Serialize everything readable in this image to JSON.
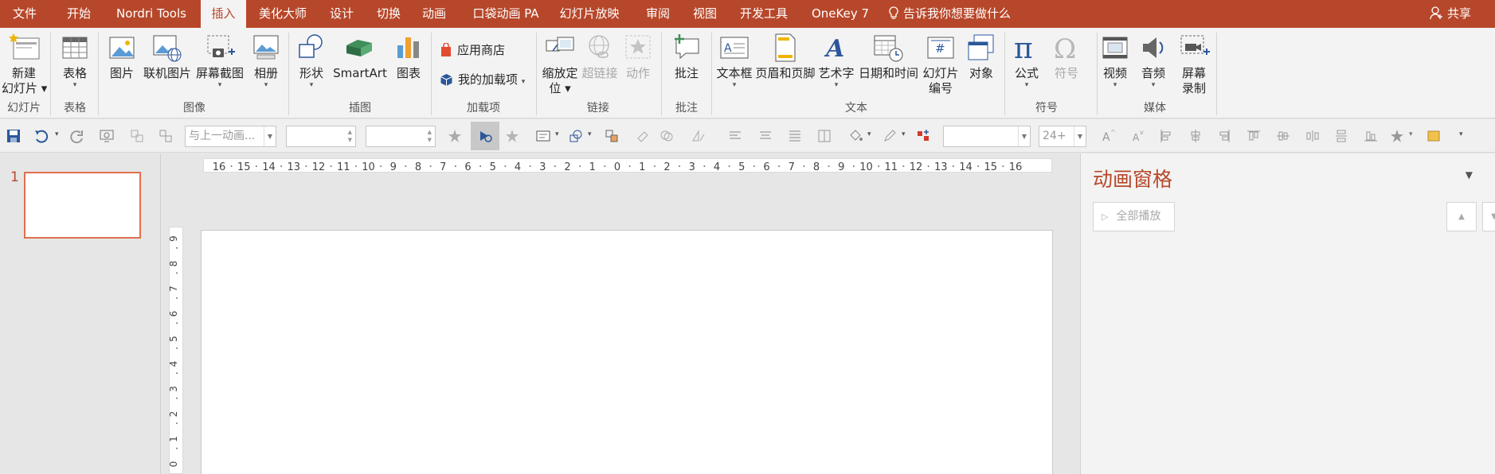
{
  "tabs": [
    {
      "label": "文件",
      "active": false
    },
    {
      "label": "开始",
      "active": false
    },
    {
      "label": "Nordri Tools",
      "active": false
    },
    {
      "label": "插入",
      "active": true
    },
    {
      "label": "美化大师",
      "active": false
    },
    {
      "label": "设计",
      "active": false
    },
    {
      "label": "切换",
      "active": false
    },
    {
      "label": "动画",
      "active": false
    },
    {
      "label": "口袋动画 PA",
      "active": false
    },
    {
      "label": "幻灯片放映",
      "active": false
    },
    {
      "label": "审阅",
      "active": false
    },
    {
      "label": "视图",
      "active": false
    },
    {
      "label": "开发工具",
      "active": false
    },
    {
      "label": "OneKey 7",
      "active": false
    }
  ],
  "tell_me": "告诉我你想要做什么",
  "share_label": "共享",
  "ribbon": {
    "new_slide": [
      "新建",
      "幻灯片"
    ],
    "table": "表格",
    "picture": "图片",
    "online_picture": "联机图片",
    "screenshot": "屏幕截图",
    "album": "相册",
    "shapes": "形状",
    "smartart": "SmartArt",
    "chart": "图表",
    "app_store": "应用商店",
    "my_addins": "我的加载项",
    "zoom": [
      "缩放定",
      "位"
    ],
    "link": "超链接",
    "action": "动作",
    "comment": "批注",
    "textbox": "文本框",
    "header_footer": "页眉和页脚",
    "wordart": "艺术字",
    "datetime": "日期和时间",
    "slide_number": [
      "幻灯片",
      "编号"
    ],
    "object": "对象",
    "equation": "公式",
    "symbol": "符号",
    "video": "视频",
    "audio": "音频",
    "screen_record": [
      "屏幕",
      "录制"
    ],
    "groups": {
      "slides": "幻灯片",
      "tables": "表格",
      "images": "图像",
      "illustrations": "插图",
      "addins": "加载项",
      "links": "链接",
      "comments": "批注",
      "text": "文本",
      "symbols": "符号",
      "media": "媒体"
    }
  },
  "toolbar": {
    "with_previous_placeholder": "与上一动画...",
    "font_size": "24+"
  },
  "thumbnails": [
    {
      "number": "1"
    }
  ],
  "hruler_ticks": [
    "16",
    "15",
    "14",
    "13",
    "12",
    "11",
    "10",
    "9",
    "8",
    "7",
    "6",
    "5",
    "4",
    "3",
    "2",
    "1",
    "0",
    "1",
    "2",
    "3",
    "4",
    "5",
    "6",
    "7",
    "8",
    "9",
    "10",
    "11",
    "12",
    "13",
    "14",
    "15",
    "16"
  ],
  "vruler_ticks": [
    "9",
    "8",
    "7",
    "6",
    "5",
    "4",
    "3",
    "2",
    "1",
    "0"
  ],
  "animation_pane": {
    "title": "动画窗格",
    "play_all": "全部播放"
  },
  "colors": {
    "accent": "#b7472a",
    "ribbon_bg": "#f3f3f3",
    "workspace_bg": "#e6e6e6"
  }
}
